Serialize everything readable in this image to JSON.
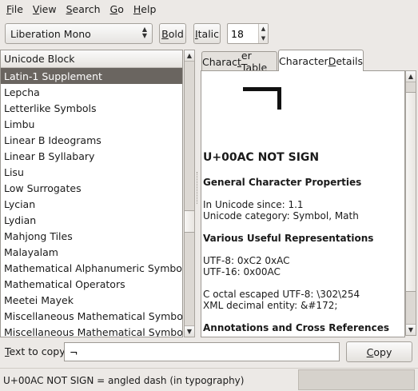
{
  "menubar": {
    "items": [
      {
        "label": "File",
        "mnemonic": "F",
        "rest": "ile"
      },
      {
        "label": "View",
        "mnemonic": "V",
        "rest": "iew"
      },
      {
        "label": "Search",
        "mnemonic": "S",
        "rest": "earch"
      },
      {
        "label": "Go",
        "mnemonic": "G",
        "rest": "o"
      },
      {
        "label": "Help",
        "mnemonic": "H",
        "rest": "elp"
      }
    ]
  },
  "toolbar": {
    "font_family": "Liberation Mono",
    "bold": {
      "mnemonic": "B",
      "rest": "old"
    },
    "italic": {
      "mnemonic": "I",
      "rest": "talic"
    },
    "font_size": "18"
  },
  "block_list": {
    "header": "Unicode Block",
    "selected_index": 0,
    "items": [
      "Latin-1 Supplement",
      "Lepcha",
      "Letterlike Symbols",
      "Limbu",
      "Linear B Ideograms",
      "Linear B Syllabary",
      "Lisu",
      "Low Surrogates",
      "Lycian",
      "Lydian",
      "Mahjong Tiles",
      "Malayalam",
      "Mathematical Alphanumeric Symbols",
      "Mathematical Operators",
      "Meetei Mayek",
      "Miscellaneous Mathematical Symbols-A",
      "Miscellaneous Mathematical Symbols-B"
    ]
  },
  "tabs": {
    "table": {
      "pre": "Charac",
      "mnemonic": "t",
      "post": "er Table"
    },
    "details": {
      "pre": "Character ",
      "mnemonic": "D",
      "post": "etails"
    }
  },
  "details": {
    "title": "U+00AC NOT SIGN",
    "section1": "General Character Properties",
    "unicode_since": "In Unicode since: 1.1",
    "category": "Unicode category: Symbol, Math",
    "section2": "Various Useful Representations",
    "utf8": "UTF-8: 0xC2 0xAC",
    "utf16": "UTF-16: 0x00AC",
    "octal": "C octal escaped UTF-8: \\302\\254",
    "xml": "XML decimal entity: &#172;",
    "section3": "Annotations and Cross References"
  },
  "copy": {
    "label_mnemonic": "T",
    "label_rest": "ext to copy:",
    "value": "¬",
    "button_mnemonic": "C",
    "button_rest": "opy"
  },
  "status": {
    "text": "U+00AC NOT SIGN   = angled dash (in typography)"
  }
}
